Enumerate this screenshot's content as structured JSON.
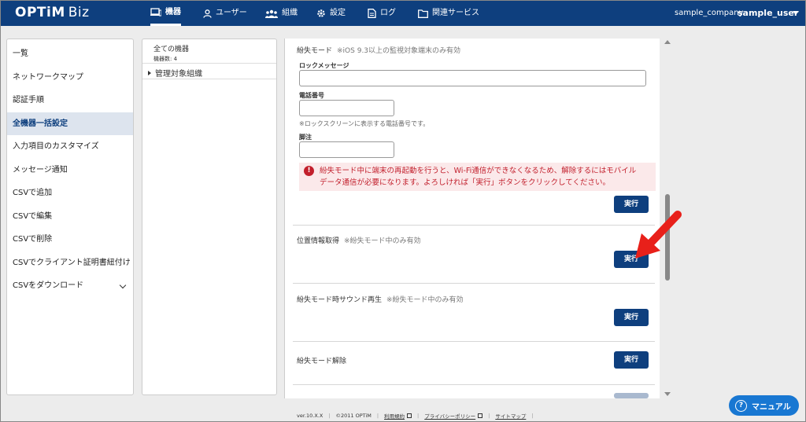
{
  "header": {
    "logo_brand": "OPTiM",
    "logo_product": "Biz",
    "nav": [
      {
        "label": "機器",
        "icon": "device-icon"
      },
      {
        "label": "ユーザー",
        "icon": "user-icon"
      },
      {
        "label": "組織",
        "icon": "organization-icon"
      },
      {
        "label": "設定",
        "icon": "gear-icon"
      },
      {
        "label": "ログ",
        "icon": "log-icon"
      },
      {
        "label": "関連サービス",
        "icon": "folder-icon"
      }
    ],
    "company": "sample_company",
    "user": "sample_user"
  },
  "sidebar": {
    "items": [
      {
        "label": "一覧"
      },
      {
        "label": "ネットワークマップ"
      },
      {
        "label": "認証手順"
      },
      {
        "label": "全機器一括設定"
      },
      {
        "label": "入力項目のカスタマイズ"
      },
      {
        "label": "メッセージ通知"
      },
      {
        "label": "CSVで追加"
      },
      {
        "label": "CSVで編集"
      },
      {
        "label": "CSVで削除"
      },
      {
        "label": "CSVでクライアント証明書紐付け"
      },
      {
        "label": "CSVをダウンロード"
      }
    ],
    "active_index": 3
  },
  "tree": {
    "title": "全ての機器",
    "count": "機器数: 4",
    "group": "管理対象組織"
  },
  "main": {
    "lost_mode": {
      "title": "紛失モード",
      "note": "※iOS 9.3以上の監視対象端末のみ有効",
      "lock_message_label": "ロックメッセージ",
      "phone_label": "電話番号",
      "phone_hint": "※ロックスクリーンに表示する電話番号です。",
      "footnote_label": "脚注",
      "warning_line1": "紛失モード中に端末の再起動を行うと、Wi-Fi通信ができなくなるため、解除するにはモバイル",
      "warning_line2": "データ通信が必要になります。よろしければ「実行」ボタンをクリックしてください。",
      "execute_label": "実行"
    },
    "location": {
      "title": "位置情報取得",
      "note": "※紛失モード中のみ有効",
      "execute_label": "実行"
    },
    "sound": {
      "title": "紛失モード時サウンド再生",
      "note": "※紛失モード中のみ有効",
      "execute_label": "実行"
    },
    "unlock": {
      "title": "紛失モード解除",
      "execute_label": "実行"
    }
  },
  "footer": {
    "version": "ver.10.X.X",
    "copyright": "©2011 OPTiM",
    "terms": "利用規約",
    "privacy": "プライバシーポリシー",
    "sitemap": "サイトマップ"
  },
  "manual_button": "マニュアル",
  "colors": {
    "primary": "#0e3f7e",
    "warning_text": "#c21f2c",
    "warning_bg": "#fbe9ea",
    "manual_button": "#1877d2",
    "arrow": "#e8201a"
  }
}
